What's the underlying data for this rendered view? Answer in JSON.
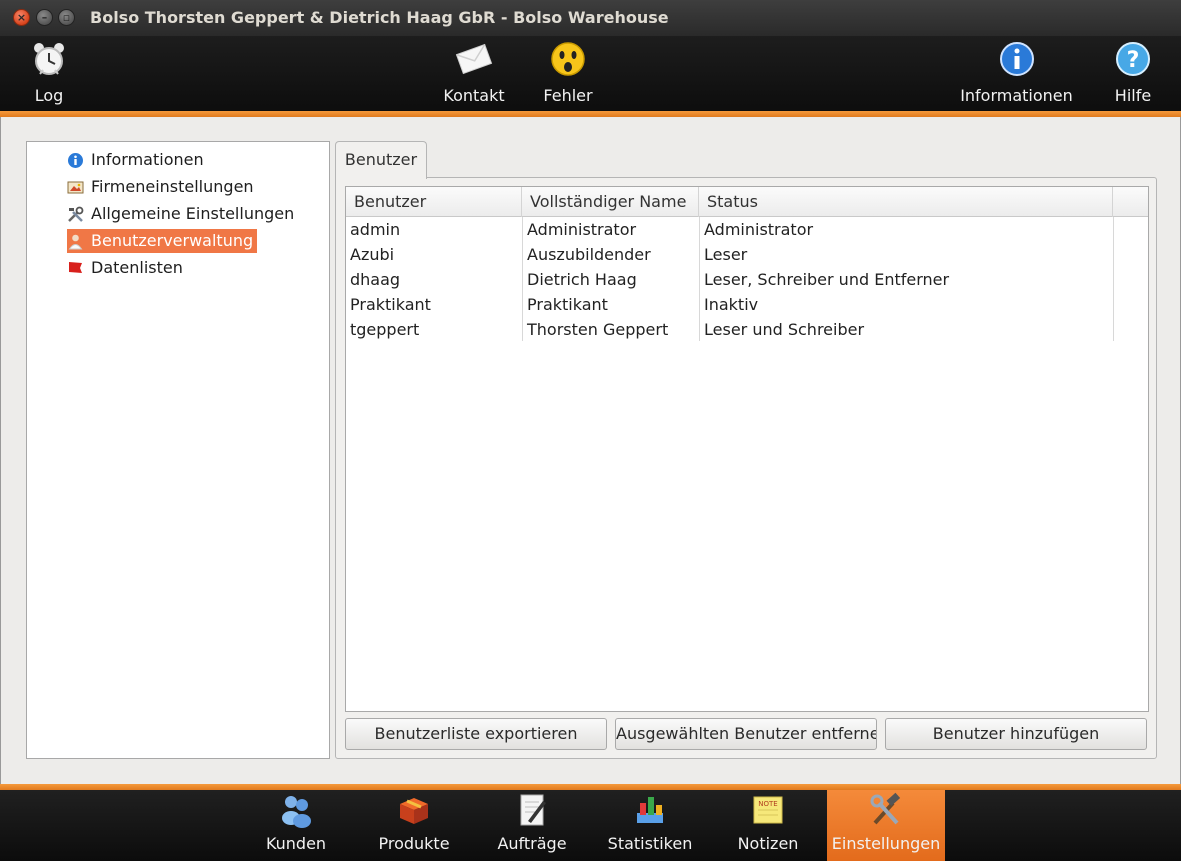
{
  "window": {
    "title": "Bolso Thorsten Geppert & Dietrich Haag GbR - Bolso Warehouse"
  },
  "toolbar": {
    "log": {
      "label": "Log",
      "icon": "alarm-clock-icon"
    },
    "kontakt": {
      "label": "Kontakt",
      "icon": "envelope-icon"
    },
    "fehler": {
      "label": "Fehler",
      "icon": "surprised-face-icon"
    },
    "informationen": {
      "label": "Informationen",
      "icon": "info-icon"
    },
    "hilfe": {
      "label": "Hilfe",
      "icon": "help-icon"
    }
  },
  "sidebar": {
    "items": [
      {
        "label": "Informationen",
        "icon": "info-icon",
        "selected": false
      },
      {
        "label": "Firmeneinstellungen",
        "icon": "company-picture-icon",
        "selected": false
      },
      {
        "label": "Allgemeine Einstellungen",
        "icon": "tools-icon",
        "selected": false
      },
      {
        "label": "Benutzerverwaltung",
        "icon": "user-icon",
        "selected": true
      },
      {
        "label": "Datenlisten",
        "icon": "flag-icon",
        "selected": false
      }
    ]
  },
  "tabs": [
    {
      "label": "Benutzer",
      "active": true
    }
  ],
  "table": {
    "headers": [
      "Benutzer",
      "Vollständiger Name",
      "Status"
    ],
    "rows": [
      [
        "admin",
        "Administrator",
        "Administrator"
      ],
      [
        "Azubi",
        "Auszubildender",
        "Leser"
      ],
      [
        "dhaag",
        "Dietrich Haag",
        "Leser, Schreiber und Entferner"
      ],
      [
        "Praktikant",
        "Praktikant",
        "Inaktiv"
      ],
      [
        "tgeppert",
        "Thorsten Geppert",
        "Leser und Schreiber"
      ]
    ]
  },
  "buttons": {
    "export": "Benutzerliste exportieren",
    "remove": "Ausgewählten Benutzer entferne",
    "add": "Benutzer hinzufügen"
  },
  "dock": {
    "items": [
      {
        "label": "Kunden",
        "icon": "customers-icon",
        "active": false
      },
      {
        "label": "Produkte",
        "icon": "product-box-icon",
        "active": false
      },
      {
        "label": "Aufträge",
        "icon": "order-pen-icon",
        "active": false
      },
      {
        "label": "Statistiken",
        "icon": "statistics-icon",
        "active": false
      },
      {
        "label": "Notizen",
        "icon": "note-icon",
        "active": false
      },
      {
        "label": "Einstellungen",
        "icon": "hammer-wrench-icon",
        "active": true
      }
    ]
  },
  "colors": {
    "accent": "#f07746",
    "orange_bar": "#e8821f",
    "toolbar_bg": "#111111"
  }
}
